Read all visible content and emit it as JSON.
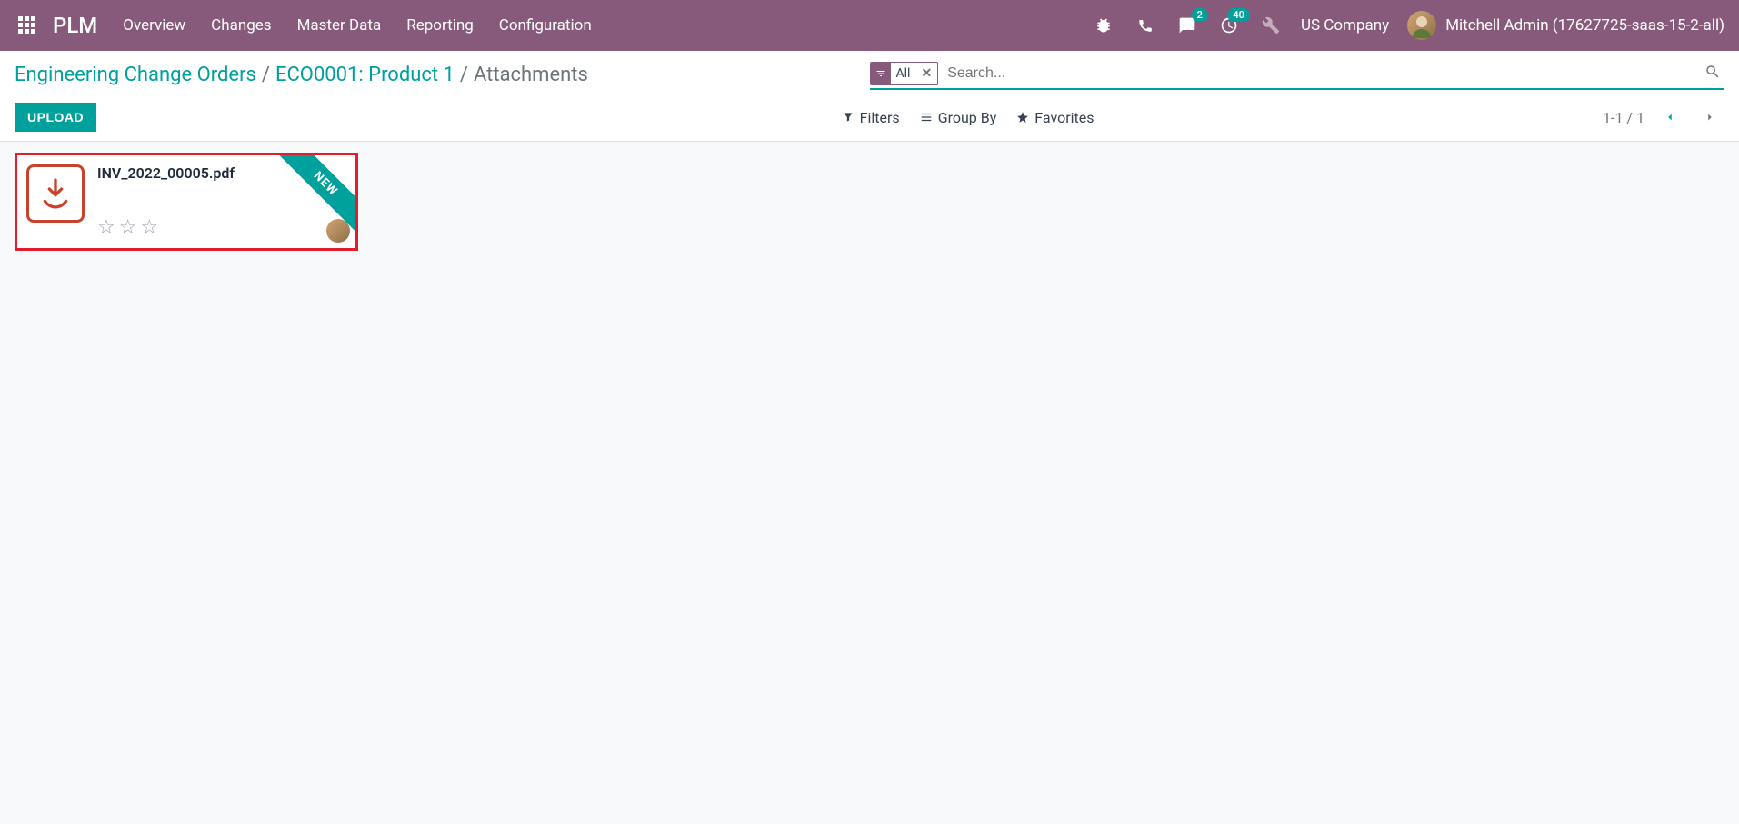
{
  "nav": {
    "brand": "PLM",
    "items": [
      "Overview",
      "Changes",
      "Master Data",
      "Reporting",
      "Configuration"
    ],
    "messages_badge": "2",
    "activities_badge": "40",
    "company": "US Company",
    "user": "Mitchell Admin (17627725-saas-15-2-all)"
  },
  "breadcrumb": {
    "root": "Engineering Change Orders",
    "record": "ECO0001: Product 1",
    "page": "Attachments"
  },
  "search": {
    "facet_label": "All",
    "placeholder": "Search..."
  },
  "filters": {
    "filters": "Filters",
    "group_by": "Group By",
    "favorites": "Favorites"
  },
  "buttons": {
    "upload": "UPLOAD"
  },
  "pager": {
    "range": "1-1",
    "sep": "/",
    "total": "1"
  },
  "attachments": [
    {
      "filename": "INV_2022_00005.pdf",
      "ribbon": "NEW"
    }
  ]
}
